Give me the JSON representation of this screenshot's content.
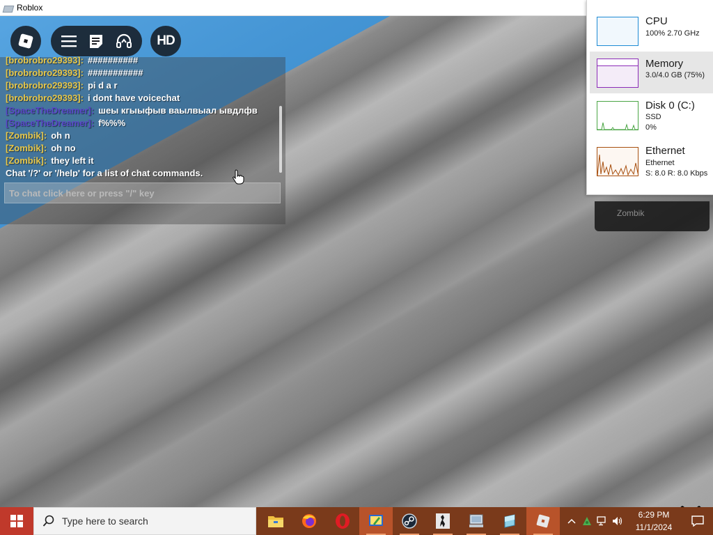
{
  "window": {
    "title": "Roblox"
  },
  "game": {
    "hd_label": "HD",
    "chat": {
      "messages": [
        {
          "name": "[brobrobro29393]:",
          "text": "###########",
          "name_color": "#e8c84a"
        },
        {
          "name": "[brobrobro29393]:",
          "text": "pi d a r",
          "name_color": "#e8c84a"
        },
        {
          "name": "[brobrobro29393]:",
          "text": "i dont have voicechat",
          "name_color": "#e8c84a"
        },
        {
          "name": "[SpaceTheDreamer]:",
          "text": "шеы кгыыфыв ваылвыал ывдлфв",
          "name_color": "#6a5acd"
        },
        {
          "name": "[SpaceTheDreamer]:",
          "text": "f%%%",
          "name_color": "#6a5acd"
        },
        {
          "name": "[Zombik]:",
          "text": "oh n",
          "name_color": "#e8c84a"
        },
        {
          "name": "[Zombik]:",
          "text": "oh no",
          "name_color": "#e8c84a"
        },
        {
          "name": "[Zombik]:",
          "text": "they left it",
          "name_color": "#e8c84a"
        },
        {
          "name": "",
          "text": "Chat '/?' or '/help' for a list of chat commands.",
          "name_color": "#ffffff"
        }
      ],
      "input_placeholder": "To chat click here or press \"/\" key"
    },
    "player_list": {
      "player": "Zombik"
    }
  },
  "task_manager": {
    "items": [
      {
        "label": "CPU",
        "sub1": "100% 2.70 GHz",
        "sub2": "",
        "sub3": "",
        "color": "#1c8ad4",
        "selected": false
      },
      {
        "label": "Memory",
        "sub1": "3.0/4.0 GB (75%)",
        "sub2": "",
        "sub3": "",
        "color": "#8b2ab7",
        "selected": true
      },
      {
        "label": "Disk 0 (C:)",
        "sub1": "SSD",
        "sub2": "0%",
        "sub3": "",
        "color": "#4aa544",
        "selected": false
      },
      {
        "label": "Ethernet",
        "sub1": "Ethernet",
        "sub2": "S: 8.0 R: 8.0 Kbps",
        "sub3": "",
        "color": "#a74f0f",
        "selected": false
      }
    ]
  },
  "taskbar": {
    "search_placeholder": "Type here to search",
    "apps": [
      "file-explorer-icon",
      "firefox-icon",
      "opera-icon",
      "paint-icon",
      "steam-icon",
      "counter-strike-icon",
      "system-icon",
      "app-icon",
      "roblox-icon"
    ],
    "active_app": "roblox-icon",
    "time": "6:29 PM",
    "date": "11/1/2024"
  },
  "colors": {
    "taskbar": "#7a3a1b",
    "start": "#c0392b",
    "sky": "#3b8fd0"
  }
}
